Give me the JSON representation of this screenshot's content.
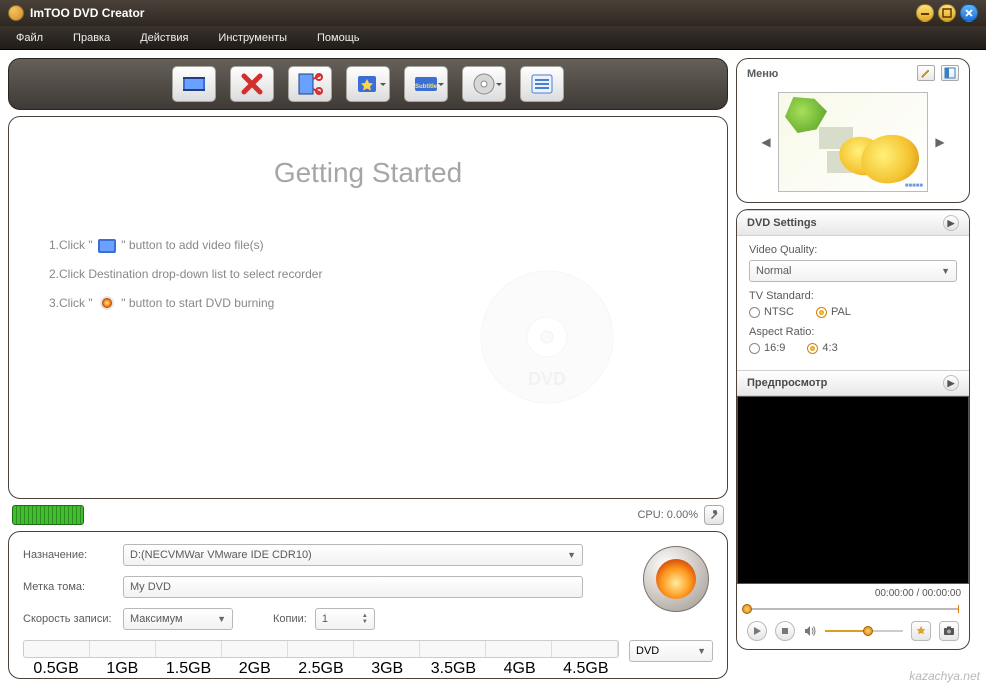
{
  "app": {
    "title": "ImTOO DVD Creator"
  },
  "menubar": [
    "Файл",
    "Правка",
    "Действия",
    "Инструменты",
    "Помощь"
  ],
  "toolbar_icons": [
    "add-video-icon",
    "remove-icon",
    "clip-icon",
    "effects-icon",
    "subtitle-icon",
    "audio-icon",
    "list-icon"
  ],
  "main": {
    "heading": "Getting Started",
    "step1_a": "1.Click \"",
    "step1_b": "\" button to add video file(s)",
    "step2": "2.Click Destination drop-down list to select recorder",
    "step3_a": "3.Click \"",
    "step3_b": "\" button to start DVD burning"
  },
  "status": {
    "cpu": "CPU: 0.00%"
  },
  "form": {
    "dest_label": "Назначение:",
    "dest_value": "D:(NECVMWar VMware IDE CDR10)",
    "vol_label": "Метка тома:",
    "vol_value": "My DVD",
    "speed_label": "Скорость записи:",
    "speed_value": "Максимум",
    "copies_label": "Копии:",
    "copies_value": "1",
    "ruler": [
      "0.5GB",
      "1GB",
      "1.5GB",
      "2GB",
      "2.5GB",
      "3GB",
      "3.5GB",
      "4GB",
      "4.5GB"
    ],
    "disc_type": "DVD"
  },
  "right": {
    "menu_title": "Меню",
    "dvd_settings_title": "DVD Settings",
    "video_quality_label": "Video Quality:",
    "video_quality_value": "Normal",
    "tv_standard_label": "TV Standard:",
    "tv_ntsc": "NTSC",
    "tv_pal": "PAL",
    "aspect_label": "Aspect Ratio:",
    "aspect_169": "16:9",
    "aspect_43": "4:3",
    "preview_title": "Предпросмотр",
    "time": "00:00:00 / 00:00:00"
  },
  "watermark": "kazachya.net"
}
